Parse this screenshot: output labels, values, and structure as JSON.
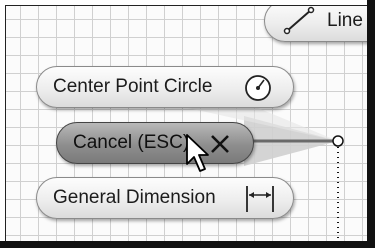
{
  "marking_menu": {
    "items": [
      {
        "id": "line",
        "label": "Line",
        "icon": "line-icon"
      },
      {
        "id": "center-point-circle",
        "label": "Center Point Circle",
        "icon": "circle-center-icon"
      },
      {
        "id": "cancel",
        "label": "Cancel (ESC)",
        "icon": "close-icon"
      },
      {
        "id": "general-dimension",
        "label": "General Dimension",
        "icon": "dimension-icon"
      }
    ]
  },
  "colors": {
    "grid_line": "#d0d0d0",
    "canvas_bg": "#fbfbfb",
    "pill_border": "#8a8a8a",
    "cancel_bg": "#8e8e8e"
  }
}
